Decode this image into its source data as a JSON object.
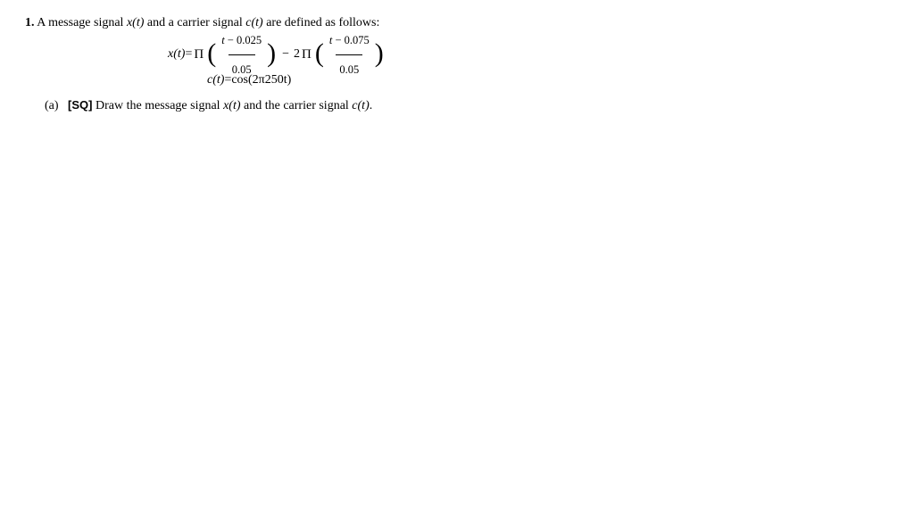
{
  "problem": {
    "number": "1.",
    "intro_pre": "A message signal ",
    "intro_x": "x(t)",
    "intro_mid": " and a carrier signal ",
    "intro_c": "c(t)",
    "intro_post": " are defined as follows:"
  },
  "eq1": {
    "lhs_var": "x(t)",
    "equals": " = ",
    "Pi1": "Π",
    "frac1_num_var": "t",
    "frac1_num_rest": " − 0.025",
    "frac1_den": "0.05",
    "minus": "−",
    "coef2": "2",
    "Pi2": "Π",
    "frac2_num_var": "t",
    "frac2_num_rest": " − 0.075",
    "frac2_den": "0.05"
  },
  "eq2": {
    "lhs_var": "c(t)",
    "equals": " = ",
    "rhs": "cos(2π250t)"
  },
  "subpart": {
    "label": "(a)",
    "sq": "[SQ]",
    "text_pre": " Draw the message signal ",
    "x": "x(t)",
    "text_mid": " and the carrier signal ",
    "c": "c(t)",
    "text_post": "."
  }
}
